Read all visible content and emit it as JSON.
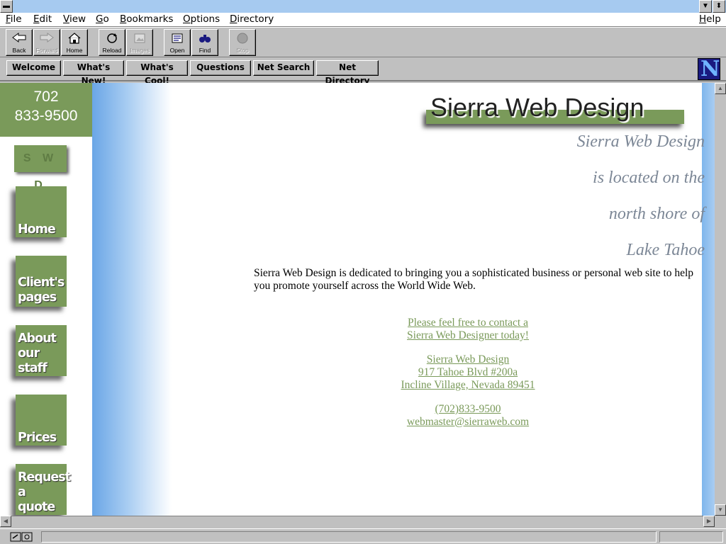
{
  "menubar": {
    "items": [
      {
        "label": "File",
        "key": "F",
        "rest": "ile"
      },
      {
        "label": "Edit",
        "key": "E",
        "rest": "dit"
      },
      {
        "label": "View",
        "key": "V",
        "rest": "iew"
      },
      {
        "label": "Go",
        "key": "G",
        "rest": "o"
      },
      {
        "label": "Bookmarks",
        "key": "B",
        "rest": "ookmarks"
      },
      {
        "label": "Options",
        "key": "O",
        "rest": "ptions"
      },
      {
        "label": "Directory",
        "key": "D",
        "rest": "irectory"
      },
      {
        "label": "Help",
        "key": "H",
        "rest": "elp"
      }
    ]
  },
  "toolbar": {
    "back": "Back",
    "forward": "Forward",
    "home": "Home",
    "reload": "Reload",
    "images": "Images",
    "open": "Open",
    "find": "Find",
    "stop": "Stop"
  },
  "directory": {
    "welcome": "Welcome",
    "whats_new": "What's New!",
    "whats_cool": "What's Cool!",
    "questions": "Questions",
    "net_search": "Net Search",
    "net_directory": "Net Directory",
    "logo_letter": "N"
  },
  "page": {
    "phone_line1": "702",
    "phone_line2": "833-9500",
    "swd": "S W D",
    "nav": {
      "home": [
        "Home"
      ],
      "clients": [
        "Client's",
        "pages"
      ],
      "about": [
        "About",
        "our",
        "staff"
      ],
      "prices": [
        "Prices"
      ],
      "request": [
        "Request",
        "a",
        "quote"
      ]
    },
    "logo": "Sierra Web Design",
    "tagline": [
      "Sierra Web Design",
      "is located on the",
      "north shore of",
      "Lake Tahoe"
    ],
    "intro": "Sierra Web Design is dedicated to bringing you a sophisticated business or personal web site to help you promote yourself across the World Wide Web.",
    "contact_line1": "Please feel free to contact a",
    "contact_line2": "Sierra Web Designer today!",
    "address_name": "Sierra Web Design",
    "address_street": "917 Tahoe Blvd #200a",
    "address_city": "Incline Village, Nevada 89451",
    "phone_link": "(702)833-9500",
    "email_link": "webmaster@sierraweb.com"
  },
  "colors": {
    "accent_green": "#7a9a5a",
    "title_blue": "#a6caf0",
    "tagline_gray": "#7c8796"
  }
}
